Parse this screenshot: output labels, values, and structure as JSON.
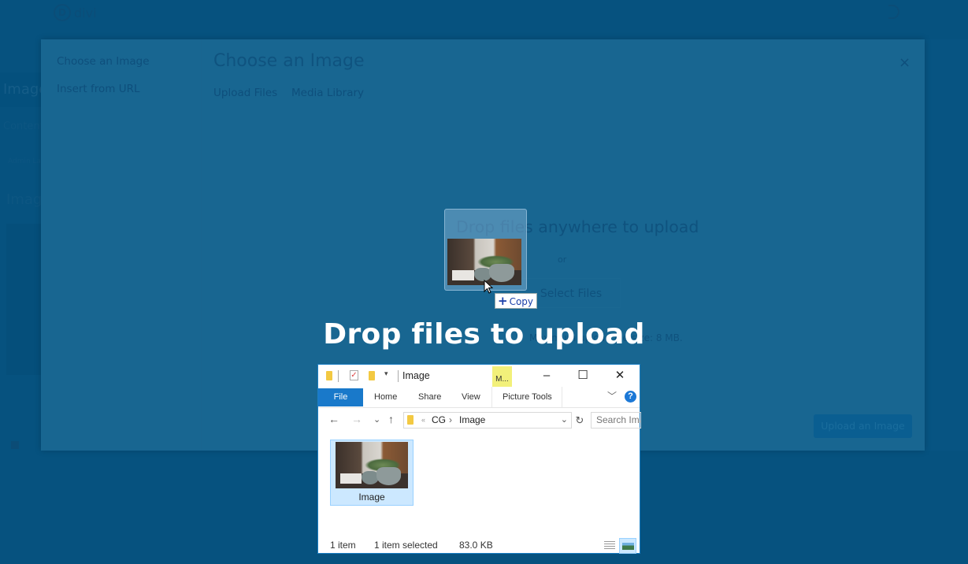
{
  "background_app": {
    "logo_letter": "D",
    "logo_text": "divi",
    "left_tab_label": "Image",
    "left_sub_label": "Content",
    "left_sub2_label": "Admin Label",
    "left_title": "Image"
  },
  "modal": {
    "sidebar": [
      {
        "label": "Choose an Image"
      },
      {
        "label": "Insert from URL"
      }
    ],
    "title": "Choose an Image",
    "tabs": [
      {
        "label": "Upload Files"
      },
      {
        "label": "Media Library"
      }
    ],
    "close_icon": "×",
    "drop_heading": "Drop files anywhere to upload",
    "or_text": "or",
    "select_files_label": "Select Files",
    "max_size_text": "Maximum upload file size: 8 MB.",
    "primary_button_label": "Upload an Image"
  },
  "overlay": {
    "drop_text": "Drop files to upload"
  },
  "drag": {
    "tooltip_plus": "+",
    "tooltip_label": "Copy"
  },
  "explorer": {
    "window_title": "Image",
    "context_tab": "M...",
    "window_controls": {
      "minimize": "–",
      "maximize": "☐",
      "close": "✕"
    },
    "ribbon_tabs": [
      {
        "label": "File"
      },
      {
        "label": "Home"
      },
      {
        "label": "Share"
      },
      {
        "label": "View"
      },
      {
        "label": "Picture Tools"
      }
    ],
    "help_label": "?",
    "nav": {
      "back": "←",
      "forward": "→",
      "recent": "⌄",
      "up": "↑",
      "refresh": "↻"
    },
    "address": {
      "overflow": "«",
      "path": [
        "CG",
        "Image"
      ],
      "separator": "›"
    },
    "search_placeholder": "Search Image",
    "files": [
      {
        "name": "Image",
        "selected": true
      }
    ],
    "status": {
      "item_count": "1 item",
      "selected": "1 item selected",
      "size": "83.0 KB"
    },
    "view_mode": "large-icons"
  },
  "colors": {
    "overlay_bg": "#075482",
    "modal_bg": "#186691",
    "explorer_accent": "#1979ca",
    "selection": "#cce8ff",
    "context_tab": "#f2f07a"
  }
}
